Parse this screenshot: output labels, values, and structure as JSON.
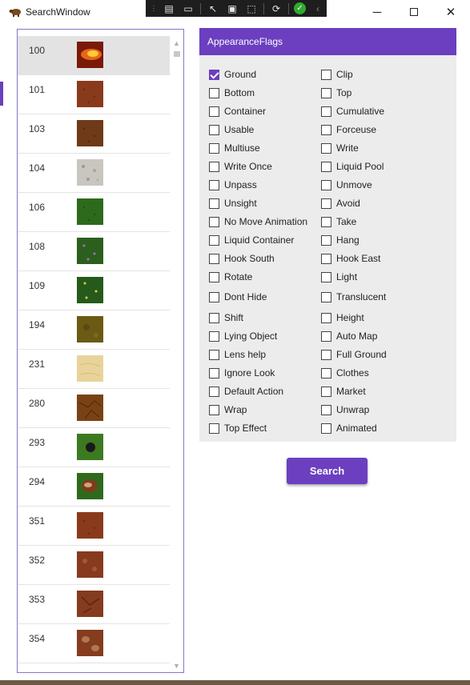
{
  "window": {
    "title": "SearchWindow"
  },
  "list": {
    "items": [
      {
        "id": "100",
        "tex": "fire"
      },
      {
        "id": "101",
        "tex": "dirt-red"
      },
      {
        "id": "103",
        "tex": "dirt-brown"
      },
      {
        "id": "104",
        "tex": "gravel"
      },
      {
        "id": "106",
        "tex": "grass"
      },
      {
        "id": "108",
        "tex": "grass-flowers-purple"
      },
      {
        "id": "109",
        "tex": "grass-flowers-yellow"
      },
      {
        "id": "194",
        "tex": "swamp"
      },
      {
        "id": "231",
        "tex": "sand"
      },
      {
        "id": "280",
        "tex": "mud-cracked"
      },
      {
        "id": "293",
        "tex": "grass-hole"
      },
      {
        "id": "294",
        "tex": "grass-rocks"
      },
      {
        "id": "351",
        "tex": "dirt-red"
      },
      {
        "id": "352",
        "tex": "dirt-red-spots"
      },
      {
        "id": "353",
        "tex": "dirt-red-cracks"
      },
      {
        "id": "354",
        "tex": "dirt-red-stones"
      }
    ],
    "selected_index": 0
  },
  "flags": {
    "header": "AppearanceFlags",
    "left": [
      {
        "label": "Ground",
        "checked": true
      },
      {
        "label": "Bottom",
        "checked": false
      },
      {
        "label": "Container",
        "checked": false
      },
      {
        "label": "Usable",
        "checked": false
      },
      {
        "label": "Multiuse",
        "checked": false
      },
      {
        "label": "Write Once",
        "checked": false
      },
      {
        "label": "Unpass",
        "checked": false
      },
      {
        "label": "Unsight",
        "checked": false
      },
      {
        "label": "No Move Animation",
        "checked": false
      },
      {
        "label": "Liquid Container",
        "checked": false
      },
      {
        "label": "Hook South",
        "checked": false
      },
      {
        "label": "Rotate",
        "checked": false
      },
      {
        "label": "Dont Hide",
        "checked": false
      },
      {
        "label": "Shift",
        "checked": false
      },
      {
        "label": "Lying Object",
        "checked": false
      },
      {
        "label": "Lens help",
        "checked": false
      },
      {
        "label": "Ignore Look",
        "checked": false
      },
      {
        "label": "Default Action",
        "checked": false
      },
      {
        "label": "Wrap",
        "checked": false
      },
      {
        "label": "Top Effect",
        "checked": false
      }
    ],
    "right": [
      {
        "label": "Clip",
        "checked": false
      },
      {
        "label": "Top",
        "checked": false
      },
      {
        "label": "Cumulative",
        "checked": false
      },
      {
        "label": "Forceuse",
        "checked": false
      },
      {
        "label": "Write",
        "checked": false
      },
      {
        "label": "Liquid Pool",
        "checked": false
      },
      {
        "label": "Unmove",
        "checked": false
      },
      {
        "label": "Avoid",
        "checked": false
      },
      {
        "label": "Take",
        "checked": false
      },
      {
        "label": "Hang",
        "checked": false
      },
      {
        "label": "Hook East",
        "checked": false
      },
      {
        "label": "Light",
        "checked": false
      },
      {
        "label": "Translucent",
        "checked": false
      },
      {
        "label": "Height",
        "checked": false
      },
      {
        "label": "Auto Map",
        "checked": false
      },
      {
        "label": "Full Ground",
        "checked": false
      },
      {
        "label": "Clothes",
        "checked": false
      },
      {
        "label": "Market",
        "checked": false
      },
      {
        "label": "Unwrap",
        "checked": false
      },
      {
        "label": "Animated",
        "checked": false
      }
    ]
  },
  "actions": {
    "search_label": "Search"
  },
  "colors": {
    "accent": "#6b3fbf",
    "panel": "#ececec",
    "selected_row": "#e3e3e3"
  }
}
